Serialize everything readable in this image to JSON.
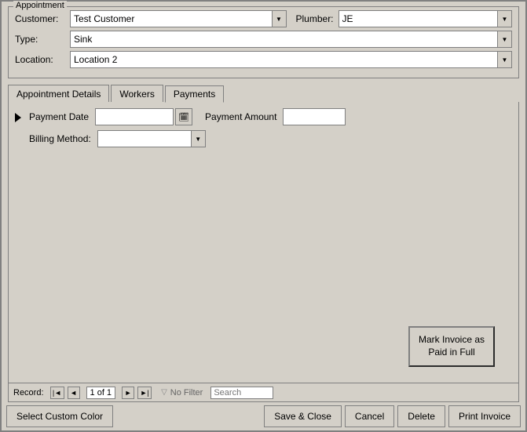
{
  "window": {
    "title": "Appointment"
  },
  "appointment": {
    "customer_label": "Customer:",
    "customer_value": "Test Customer",
    "plumber_label": "Plumber:",
    "plumber_value": "JE",
    "type_label": "Type:",
    "type_value": "Sink",
    "location_label": "Location:",
    "location_value": "Location 2"
  },
  "tabs": {
    "tab1": "Appointment Details",
    "tab2": "Workers",
    "tab3": "Payments",
    "active": 2
  },
  "payments": {
    "payment_date_label": "Payment Date",
    "payment_amount_label": "Payment Amount",
    "billing_method_label": "Billing Method:",
    "payment_date_value": "",
    "payment_amount_value": "",
    "billing_method_value": "",
    "mark_invoice_label": "Mark Invoice as Paid in Full"
  },
  "record_nav": {
    "label": "Record:",
    "record_text": "1 of 1",
    "no_filter": "No Filter",
    "search_placeholder": "Search"
  },
  "toolbar": {
    "select_color": "Select Custom Color",
    "save_close": "Save & Close",
    "cancel": "Cancel",
    "delete": "Delete",
    "print_invoice": "Print Invoice"
  },
  "icons": {
    "dropdown": "▼",
    "calendar": "📅",
    "nav_first": "|◄",
    "nav_prev": "◄",
    "nav_next": "►",
    "nav_last": "►|",
    "arrow": "►",
    "funnel": "▽"
  }
}
